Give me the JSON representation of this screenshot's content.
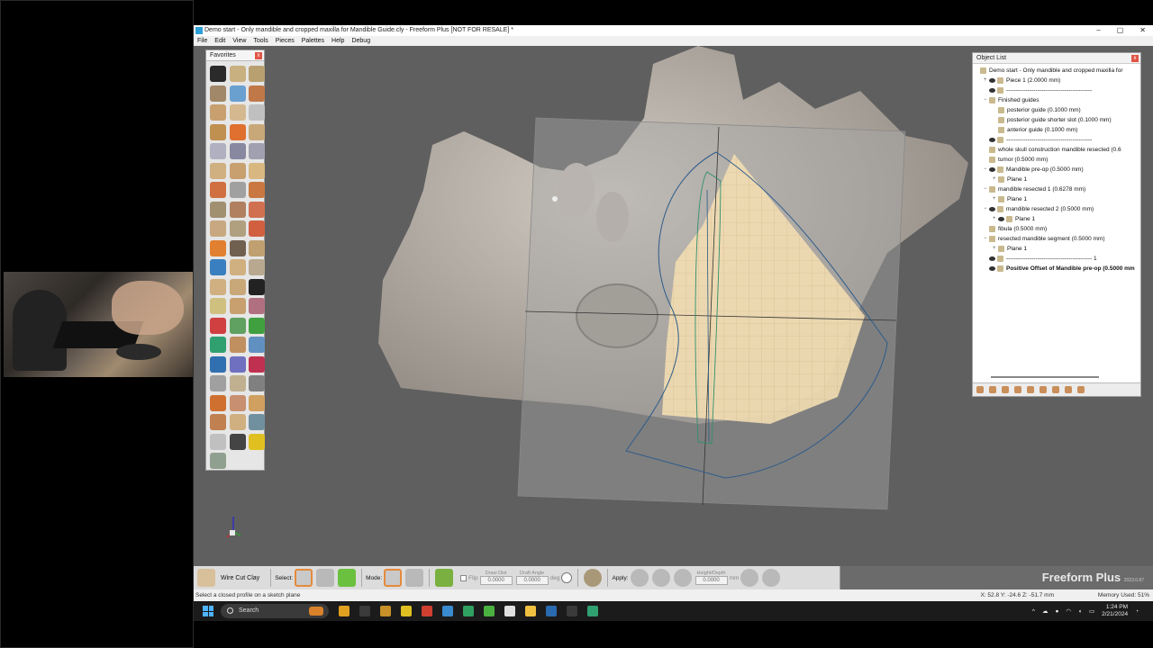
{
  "window": {
    "title": "Demo start - Only mandible and cropped maxilla for Mandible Guide.cly - Freeform Plus [NOT FOR RESALE] *",
    "controls": [
      "–",
      "▢",
      "✕"
    ]
  },
  "menu": [
    "File",
    "Edit",
    "View",
    "Tools",
    "Pieces",
    "Palettes",
    "Help",
    "Debug"
  ],
  "favorites": {
    "title": "Favorites",
    "close": "x",
    "tools": [
      "#2a2a2a",
      "#c9b080",
      "#b8a070",
      "#a08868",
      "#6aa0d0",
      "#c07848",
      "#c8a070",
      "#d4b890",
      "#c0c0c0",
      "#c09050",
      "#e07030",
      "#c8a878",
      "#b0b0c0",
      "#8888a0",
      "#a0a0b0",
      "#d0b080",
      "#c8a070",
      "#d8b880",
      "#d07040",
      "#a0a0a0",
      "#c87840",
      "#a09070",
      "#b08060",
      "#d07050",
      "#c8a880",
      "#b0a080",
      "#d06040",
      "#e08030",
      "#706050",
      "#c0a070",
      "#3a80c0",
      "#d0b080",
      "#b8a890",
      "#d0b080",
      "#c8a878",
      "#222222",
      "#d0c080",
      "#c8a070",
      "#b07080",
      "#d04040",
      "#60a060",
      "#40a040",
      "#30a070",
      "#c09060",
      "#6090c0",
      "#3070b0",
      "#7070c0",
      "#c03050",
      "#a0a0a0",
      "#c0b090",
      "#808080",
      "#d07030",
      "#c89070",
      "#d0a060",
      "#c08050",
      "#d0b080",
      "#7090a0",
      "#c0c0c0",
      "#444444",
      "#e0c020",
      "#90a090"
    ]
  },
  "object_list": {
    "title": "Object List",
    "close": "x",
    "rows": [
      {
        "indent": 0,
        "toggle": "",
        "eye": false,
        "label": "Demo start - Only mandible and cropped maxilla for",
        "bold": false
      },
      {
        "indent": 1,
        "toggle": "+",
        "eye": true,
        "label": "Piece 1 (2.0000 mm)",
        "bold": false
      },
      {
        "indent": 1,
        "toggle": "",
        "eye": true,
        "label": "--------------------------------------------",
        "bold": false
      },
      {
        "indent": 1,
        "toggle": "−",
        "eye": false,
        "label": "Finished guides",
        "bold": false
      },
      {
        "indent": 2,
        "toggle": "",
        "eye": false,
        "label": "posterior guide (0.1000 mm)",
        "bold": false
      },
      {
        "indent": 2,
        "toggle": "",
        "eye": false,
        "label": "posterior guide shorter slot (0.1000 mm)",
        "bold": false
      },
      {
        "indent": 2,
        "toggle": "",
        "eye": false,
        "label": "anterior guide (0.1000 mm)",
        "bold": false
      },
      {
        "indent": 1,
        "toggle": "",
        "eye": true,
        "label": "--------------------------------------------",
        "bold": false
      },
      {
        "indent": 1,
        "toggle": "",
        "eye": false,
        "label": "whole skull construction mandible resected (0.6",
        "bold": false
      },
      {
        "indent": 1,
        "toggle": "",
        "eye": false,
        "label": "tumor (0.5000 mm)",
        "bold": false
      },
      {
        "indent": 1,
        "toggle": "−",
        "eye": true,
        "label": "Mandible pre-op (0.5000 mm)",
        "bold": false
      },
      {
        "indent": 2,
        "toggle": "+",
        "eye": false,
        "label": "Plane 1",
        "bold": false
      },
      {
        "indent": 1,
        "toggle": "−",
        "eye": false,
        "label": "mandible resected 1 (0.6278 mm)",
        "bold": false
      },
      {
        "indent": 2,
        "toggle": "+",
        "eye": false,
        "label": "Plane 1",
        "bold": false
      },
      {
        "indent": 1,
        "toggle": "−",
        "eye": true,
        "label": "mandible resected 2 (0.5000 mm)",
        "bold": false
      },
      {
        "indent": 2,
        "toggle": "+",
        "eye": true,
        "label": "Plane 1",
        "bold": false
      },
      {
        "indent": 1,
        "toggle": "",
        "eye": false,
        "label": "fibula (0.5000 mm)",
        "bold": false
      },
      {
        "indent": 1,
        "toggle": "−",
        "eye": false,
        "label": "resected mandible segment (0.5000 mm)",
        "bold": false
      },
      {
        "indent": 2,
        "toggle": "+",
        "eye": false,
        "label": "Plane 1",
        "bold": false
      },
      {
        "indent": 1,
        "toggle": "",
        "eye": true,
        "label": "-------------------------------------------- 1",
        "bold": false
      },
      {
        "indent": 1,
        "toggle": "",
        "eye": true,
        "label": "Positive Offset of Mandible pre-op (0.5000 mm",
        "bold": true
      }
    ]
  },
  "ribbon": {
    "tool_name": "Wire Cut Clay",
    "select_label": "Select:",
    "mode_label": "Mode:",
    "flip_label": "Flip",
    "draw_dist_label": "Draw Dist",
    "draw_dist_value": "0.0000",
    "draft_angle_label": "Draft Angle",
    "draft_angle_value": "0.0000",
    "deg_label": "deg",
    "apply_label": "Apply:",
    "height_depth_label": "Height/Depth",
    "height_depth_value": "0.0000",
    "mm_label": "mm"
  },
  "brand": {
    "name": "Freeform Plus",
    "version": "2023.0.87"
  },
  "hint": "Select a closed profile on a sketch plane",
  "coords": "X: 52.8     Y: -24.6     Z: -51.7     mm",
  "memory": "Memory Used: 51%",
  "taskbar": {
    "search": "Search",
    "apps": [
      "#e0a020",
      "#3a3a3a",
      "#c89028",
      "#e0c020",
      "#d04030",
      "#3a8ad0",
      "#30a060",
      "#4ab040",
      "#e0e0e0",
      "#f0c040",
      "#2a6ab0",
      "#3a3a3a",
      "#30a070"
    ],
    "time": "1:24 PM",
    "date": "2/21/2024"
  },
  "colors": {
    "bone": "#b8b0a5",
    "guide": "#f0dcb0",
    "plane": "#9a9a9a",
    "accent": "#e58a3c"
  }
}
